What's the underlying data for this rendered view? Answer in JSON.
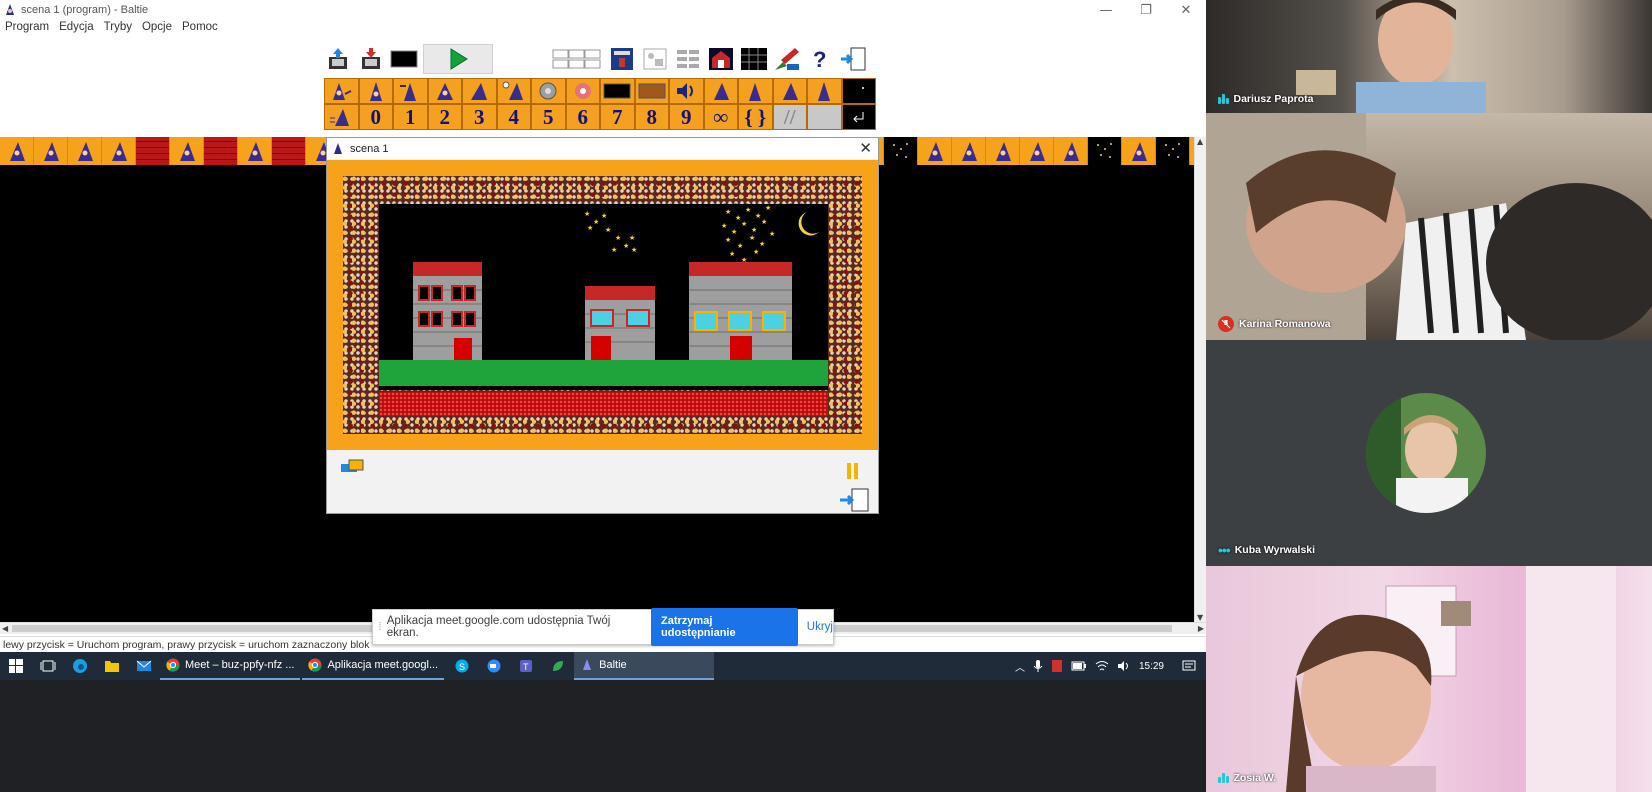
{
  "window": {
    "title": "scena 1 (program) - Baltie",
    "controls": {
      "minimize": "—",
      "restore": "❐",
      "close": "✕"
    }
  },
  "menu": [
    "Program",
    "Edycja",
    "Tryby",
    "Opcje",
    "Pomoc"
  ],
  "palette": {
    "digits": [
      "0",
      "1",
      "2",
      "3",
      "4",
      "5",
      "6",
      "7",
      "8",
      "9"
    ],
    "infinity": "∞",
    "braces": "{ }",
    "comment": "//"
  },
  "scene_dialog": {
    "title": "scena 1",
    "close": "✕"
  },
  "statusbar": {
    "text": "lewy przycisk = Uruchom program, prawy przycisk = uruchom zaznaczony blok"
  },
  "sharebar": {
    "message": "Aplikacja meet.google.com udostępnia Twój ekran.",
    "stop_label": "Zatrzymaj udostępnianie",
    "hide_label": "Ukryj"
  },
  "taskbar": {
    "apps": [
      {
        "label": "Meet – buz-ppfy-nfz ..."
      },
      {
        "label": "Aplikacja meet.googl..."
      },
      {
        "label": "Baltie"
      }
    ],
    "time": "15:29"
  },
  "participants": [
    {
      "name": "Dariusz Paprota",
      "status": "speaking"
    },
    {
      "name": "Karina Romanowa",
      "status": "muted"
    },
    {
      "name": "Kuba Wyrwalski",
      "status": "idle"
    },
    {
      "name": "Zosia W.",
      "status": "speaking"
    }
  ],
  "colors": {
    "baltie_orange": "#f7a21b",
    "palette_blue_text": "#12127a",
    "meet_background": "#202124",
    "meet_accent": "#1a73e8",
    "taskbar": "#1f2b38"
  }
}
